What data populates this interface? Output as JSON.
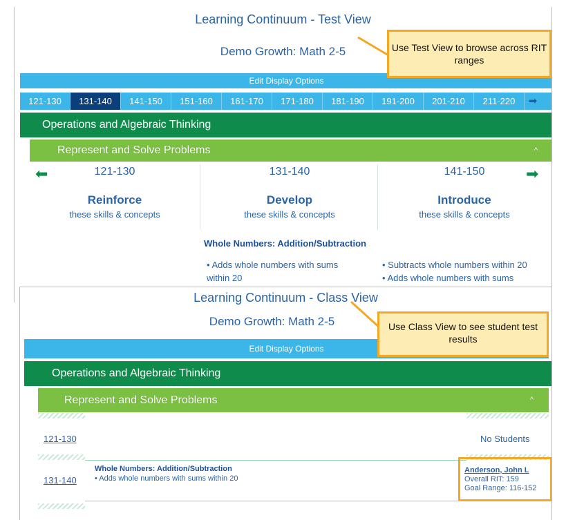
{
  "test_view": {
    "title": "Learning Continuum - Test View",
    "subtitle": "Demo Growth: Math 2-5",
    "edit_options": "Edit Display Options",
    "ranges": [
      "121-130",
      "131-140",
      "141-150",
      "151-160",
      "161-170",
      "171-180",
      "181-190",
      "191-200",
      "201-210",
      "211-220"
    ],
    "active_range": "131-140",
    "domain": "Operations and Algebraic Thinking",
    "subdomain": "Represent and Solve Problems",
    "columns": [
      {
        "range": "121-130",
        "heading": "Reinforce",
        "sub": "these skills & concepts"
      },
      {
        "range": "131-140",
        "heading": "Develop",
        "sub": "these skills & concepts"
      },
      {
        "range": "141-150",
        "heading": "Introduce",
        "sub": "these skills & concepts"
      }
    ],
    "skill_heading": "Whole Numbers: Addition/Subtraction",
    "develop_bullets": [
      "• Adds whole numbers with sums",
      "within 20"
    ],
    "introduce_bullets": [
      "• Subtracts whole numbers within 20",
      "• Adds whole numbers with sums"
    ],
    "callout": "Use Test View to browse across RIT ranges"
  },
  "class_view": {
    "title": "Learning Continuum - Class View",
    "subtitle": "Demo Growth: Math 2-5",
    "edit_options": "Edit Display Options",
    "domain": "Operations and Algebraic Thinking",
    "subdomain": "Represent and Solve Problems",
    "rows": [
      {
        "range": "121-130",
        "status": "No Students"
      },
      {
        "range": "131-140",
        "skill": "Whole Numbers: Addition/Subtraction",
        "bullet": "• Adds whole numbers with sums within 20",
        "student": "Anderson, John L",
        "overall": "Overall RIT: 159",
        "goal": "Goal Range: 116-152"
      }
    ],
    "callout": "Use Class View to see student test results"
  },
  "colors": {
    "accent_blue": "#3cb6e8",
    "dark_blue": "#0b3f7c",
    "green": "#0f8c4c",
    "lime": "#7bc043",
    "callout_border": "#f5a623"
  }
}
